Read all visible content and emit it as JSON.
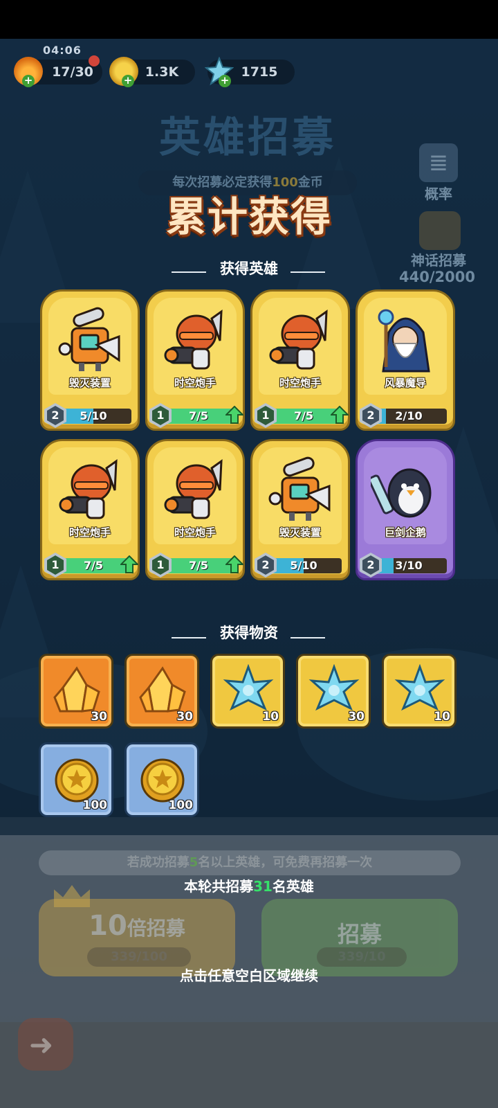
{
  "status": {
    "time": "04:06"
  },
  "resources": [
    {
      "name": "stamina",
      "value": "17/30",
      "icon": "flame-icon"
    },
    {
      "name": "gold",
      "value": "1.3K",
      "icon": "gold-coin-icon"
    },
    {
      "name": "crystal",
      "value": "1715",
      "icon": "snowflake-crystal-icon"
    }
  ],
  "background": {
    "title": "英雄招募",
    "subtitle_prefix": "每次招募必定获得",
    "subtitle_highlight": "100",
    "subtitle_suffix": "金币",
    "probability_label": "概率",
    "mythic_label": "神话招募",
    "mythic_progress": "440/2000"
  },
  "result": {
    "title": "累计获得",
    "heroes_section": "获得英雄",
    "items_section": "获得物资",
    "heroes": [
      {
        "name": "毁灭装置",
        "level": "2",
        "progress": "5/10",
        "fill": 0.5,
        "upgradable": false,
        "rarity": "gold",
        "art": "destroyer-device"
      },
      {
        "name": "时空炮手",
        "level": "1",
        "progress": "7/5",
        "fill": 1.0,
        "upgradable": true,
        "rarity": "gold",
        "art": "time-gunner"
      },
      {
        "name": "时空炮手",
        "level": "1",
        "progress": "7/5",
        "fill": 1.0,
        "upgradable": true,
        "rarity": "gold",
        "art": "time-gunner"
      },
      {
        "name": "风暴魔导",
        "level": "2",
        "progress": "2/10",
        "fill": 0.2,
        "upgradable": false,
        "rarity": "gold",
        "art": "storm-mage"
      },
      {
        "name": "时空炮手",
        "level": "1",
        "progress": "7/5",
        "fill": 1.0,
        "upgradable": true,
        "rarity": "gold",
        "art": "time-gunner"
      },
      {
        "name": "时空炮手",
        "level": "1",
        "progress": "7/5",
        "fill": 1.0,
        "upgradable": true,
        "rarity": "gold",
        "art": "time-gunner"
      },
      {
        "name": "毁灭装置",
        "level": "2",
        "progress": "5/10",
        "fill": 0.5,
        "upgradable": false,
        "rarity": "gold",
        "art": "destroyer-device"
      },
      {
        "name": "巨剑企鹅",
        "level": "2",
        "progress": "3/10",
        "fill": 0.3,
        "upgradable": false,
        "rarity": "purple",
        "art": "greatsword-penguin"
      }
    ],
    "items": [
      {
        "type": "orange-crystal",
        "count": "30",
        "frame": "orange"
      },
      {
        "type": "orange-crystal",
        "count": "30",
        "frame": "orange"
      },
      {
        "type": "blue-snowflake",
        "count": "10",
        "frame": "gold"
      },
      {
        "type": "blue-snowflake",
        "count": "30",
        "frame": "gold"
      },
      {
        "type": "blue-snowflake",
        "count": "10",
        "frame": "gold"
      },
      {
        "type": "gold-coin",
        "count": "100",
        "frame": "blue"
      },
      {
        "type": "gold-coin",
        "count": "100",
        "frame": "blue"
      }
    ]
  },
  "bottom": {
    "bonus_prefix": "若成功招募",
    "bonus_highlight": "5",
    "bonus_suffix": "名以上英雄，可免费再招募一次",
    "round_prefix": "本轮共招募",
    "round_highlight": "31",
    "round_suffix": "名英雄",
    "ten_x_label_num": "10",
    "ten_x_label_text": "倍招募",
    "ten_x_cost": "339/100",
    "recruit_label": "招募",
    "recruit_cost": "339/10",
    "continue_hint": "点击任意空白区域继续"
  },
  "colors": {
    "gold_card": "#f2cd4c",
    "purple_card": "#9b7ad8",
    "accent_green": "#36e06a",
    "title_orange": "#ffe6c2"
  }
}
